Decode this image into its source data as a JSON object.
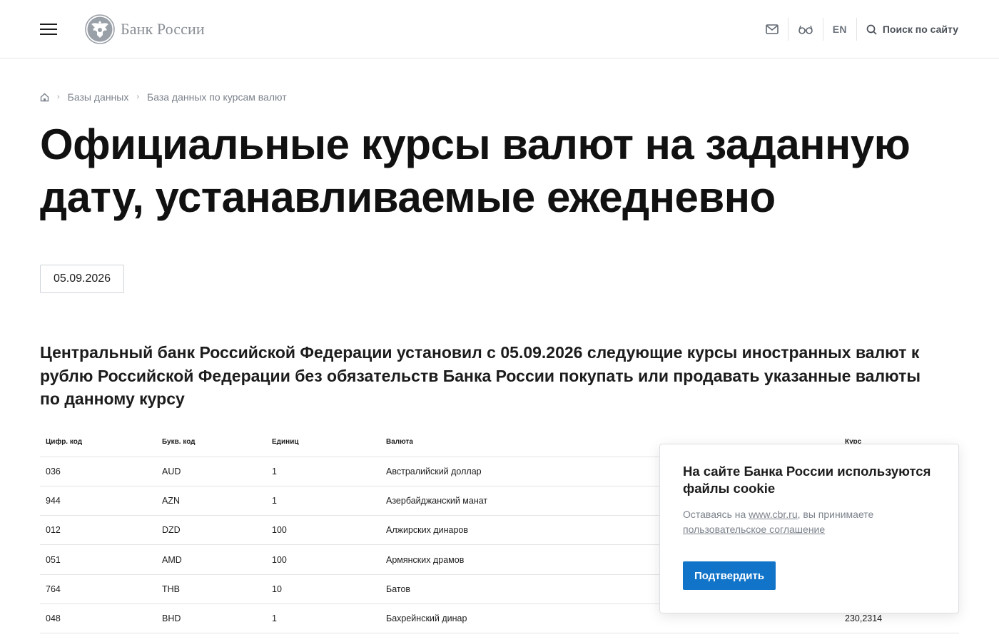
{
  "header": {
    "logo_text": "Банк России",
    "lang": "EN",
    "search_label": "Поиск по сайту"
  },
  "breadcrumb": {
    "items": [
      "Базы данных",
      "База данных по курсам валют"
    ]
  },
  "page": {
    "title": "Официальные курсы валют на заданную дату, устанавливаемые ежедневно",
    "date_value": "05.09.2026",
    "description": "Центральный банк Российской Федерации установил с 05.09.2026 следующие курсы иностранных валют к рублю Российской Федерации без обязательств Банка России покупать или продавать указанные валюты по данному курсу"
  },
  "table": {
    "headers": [
      "Цифр. код",
      "Букв. код",
      "Единиц",
      "Валюта",
      "Курс"
    ],
    "rows": [
      [
        "036",
        "AUD",
        "1",
        "Австралийский доллар",
        ""
      ],
      [
        "944",
        "AZN",
        "1",
        "Азербайджанский манат",
        ""
      ],
      [
        "012",
        "DZD",
        "100",
        "Алжирских динаров",
        ""
      ],
      [
        "051",
        "AMD",
        "100",
        "Армянских драмов",
        ""
      ],
      [
        "764",
        "THB",
        "10",
        "Батов",
        ""
      ],
      [
        "048",
        "BHD",
        "1",
        "Бахрейнский динар",
        "230,2314"
      ]
    ]
  },
  "cookie": {
    "title": "На сайте Банка России используются файлы cookie",
    "text_before": "Оставаясь на ",
    "site_link": "www.cbr.ru",
    "text_after": ", вы принимаете ",
    "agreement_link": "пользовательское соглашение",
    "confirm_label": "Подтвердить"
  },
  "colors": {
    "accent": "#1174c9",
    "text": "#1c1c1c",
    "muted": "#7c838c"
  },
  "icons": [
    "menu-icon",
    "bank-emblem-icon",
    "mail-icon",
    "glasses-icon",
    "search-icon",
    "home-icon",
    "chevron-right-icon"
  ]
}
